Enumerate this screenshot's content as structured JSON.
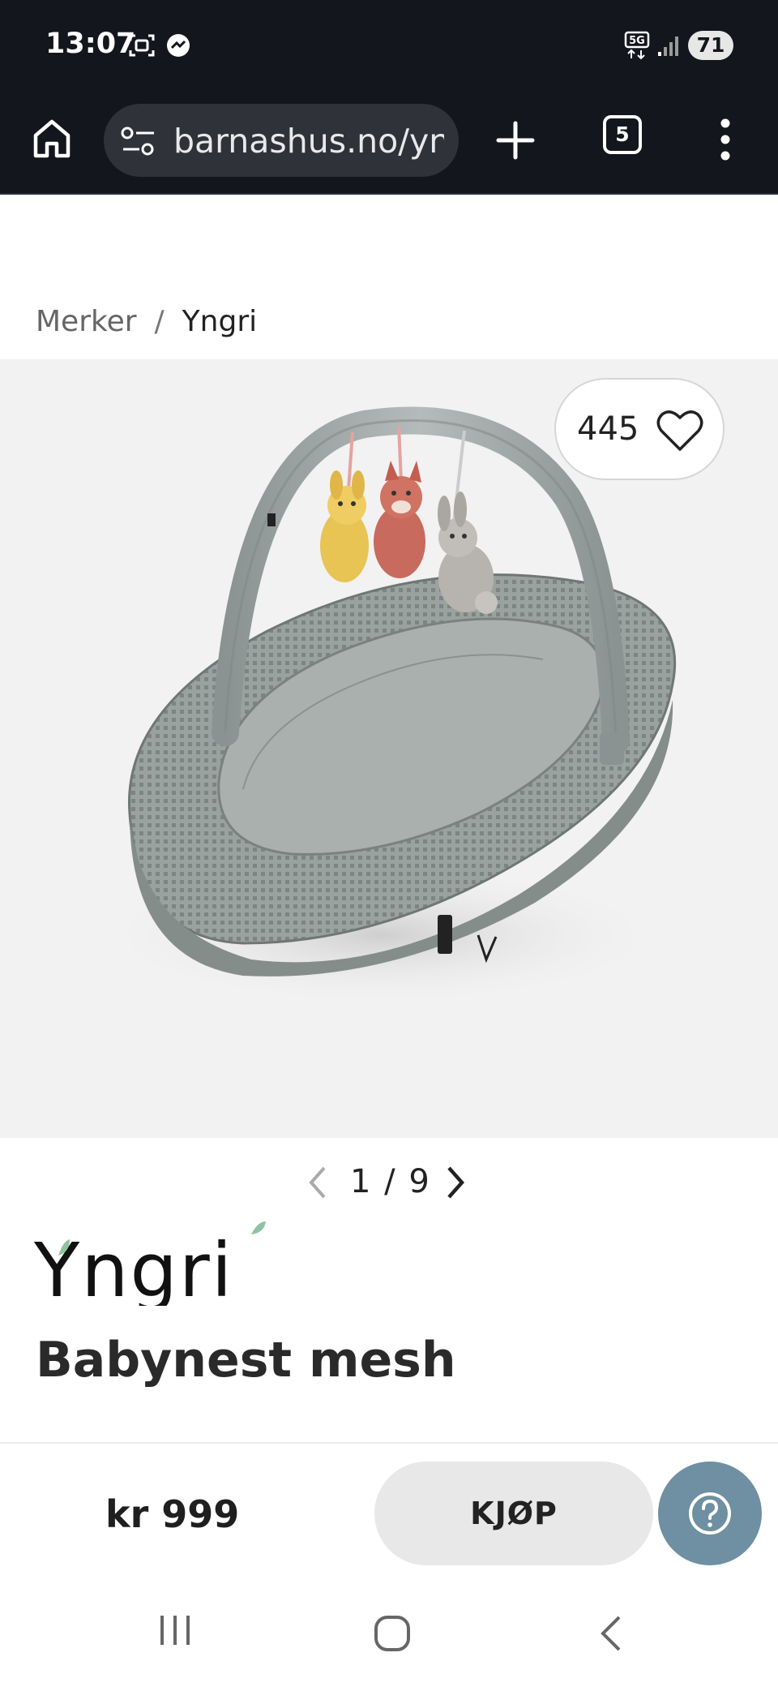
{
  "status_bar": {
    "time": "13:07",
    "network": "5G",
    "battery": "71"
  },
  "browser": {
    "url": "barnashus.no/yngri",
    "tab_count": "5"
  },
  "breadcrumb": {
    "items": [
      "Merker",
      "Yngri"
    ],
    "separator": "/"
  },
  "product": {
    "favorite_count": "445",
    "image_pager": "1 / 9",
    "brand_logo": "Yngri",
    "title": "Babynest mesh",
    "price": "kr 999",
    "buy_label": "KJØP"
  },
  "colors": {
    "status_bg": "#14161d",
    "help_button": "#6f8fa2",
    "buy_button": "#e8e8e8",
    "image_bg": "#f2f2f2",
    "logo_leaf": "#8fc2a0"
  },
  "icons": [
    "home-icon",
    "site-settings-icon",
    "plus-icon",
    "tabs-icon",
    "menu-dots-icon",
    "heart-icon",
    "chevron-left-icon",
    "chevron-right-icon",
    "help-icon",
    "recent-apps-icon",
    "home-nav-icon",
    "back-icon"
  ]
}
